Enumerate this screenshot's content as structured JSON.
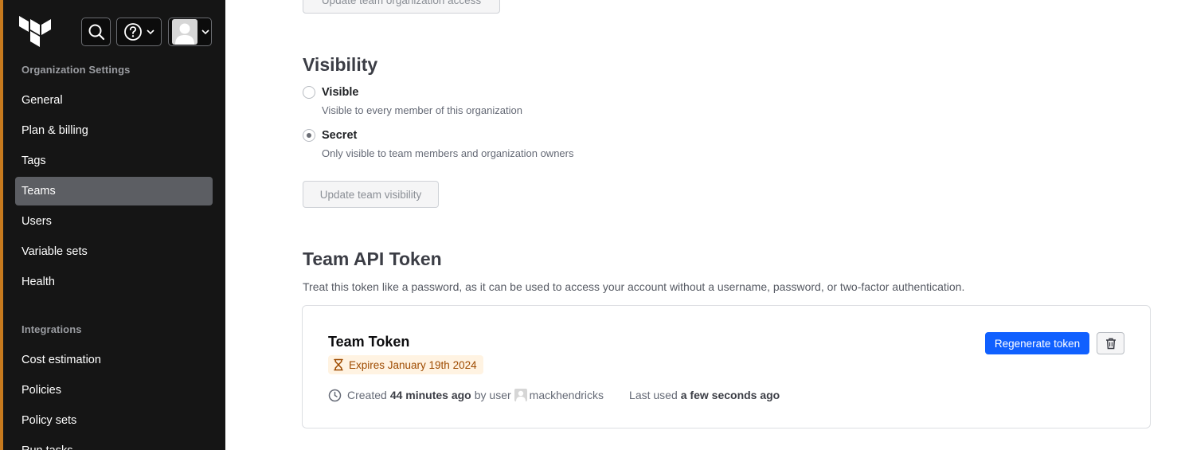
{
  "header": {
    "logo_icon": "terraform-logo-icon",
    "search_icon": "search-icon",
    "help_icon": "help-icon",
    "user_icon": "avatar"
  },
  "sidebar": {
    "section_org": "Organization Settings",
    "items": [
      {
        "label": "General"
      },
      {
        "label": "Plan & billing"
      },
      {
        "label": "Tags"
      },
      {
        "label": "Teams",
        "active": true
      },
      {
        "label": "Users"
      },
      {
        "label": "Variable sets"
      },
      {
        "label": "Health"
      }
    ],
    "section_integrations": "Integrations",
    "integrations": [
      {
        "label": "Cost estimation"
      },
      {
        "label": "Policies"
      },
      {
        "label": "Policy sets"
      },
      {
        "label": "Run tasks"
      }
    ]
  },
  "main": {
    "update_access_button": "Update team organization access",
    "visibility": {
      "title": "Visibility",
      "options": [
        {
          "label": "Visible",
          "description": "Visible to every member of this organization",
          "checked": false
        },
        {
          "label": "Secret",
          "description": "Only visible to team members and organization owners",
          "checked": true
        }
      ],
      "update_button": "Update team visibility"
    },
    "token": {
      "title": "Team API Token",
      "description": "Treat this token like a password, as it can be used to access your account without a username, password, or two-factor authentication.",
      "card_title": "Team Token",
      "expires": "Expires January 19th 2024",
      "created_prefix": "Created",
      "created_time": "44 minutes ago",
      "by_user": "by user",
      "username": "mackhendricks",
      "last_used_prefix": "Last used",
      "last_used_time": "a few seconds ago",
      "regenerate_button": "Regenerate token"
    }
  },
  "colors": {
    "sidebar_bg": "#151515",
    "accent_strip": "#c77a1e",
    "active_item_bg": "#5c5e63",
    "primary_button": "#1060ff",
    "badge_bg": "#fff3e2",
    "badge_text": "#9e4b00"
  }
}
